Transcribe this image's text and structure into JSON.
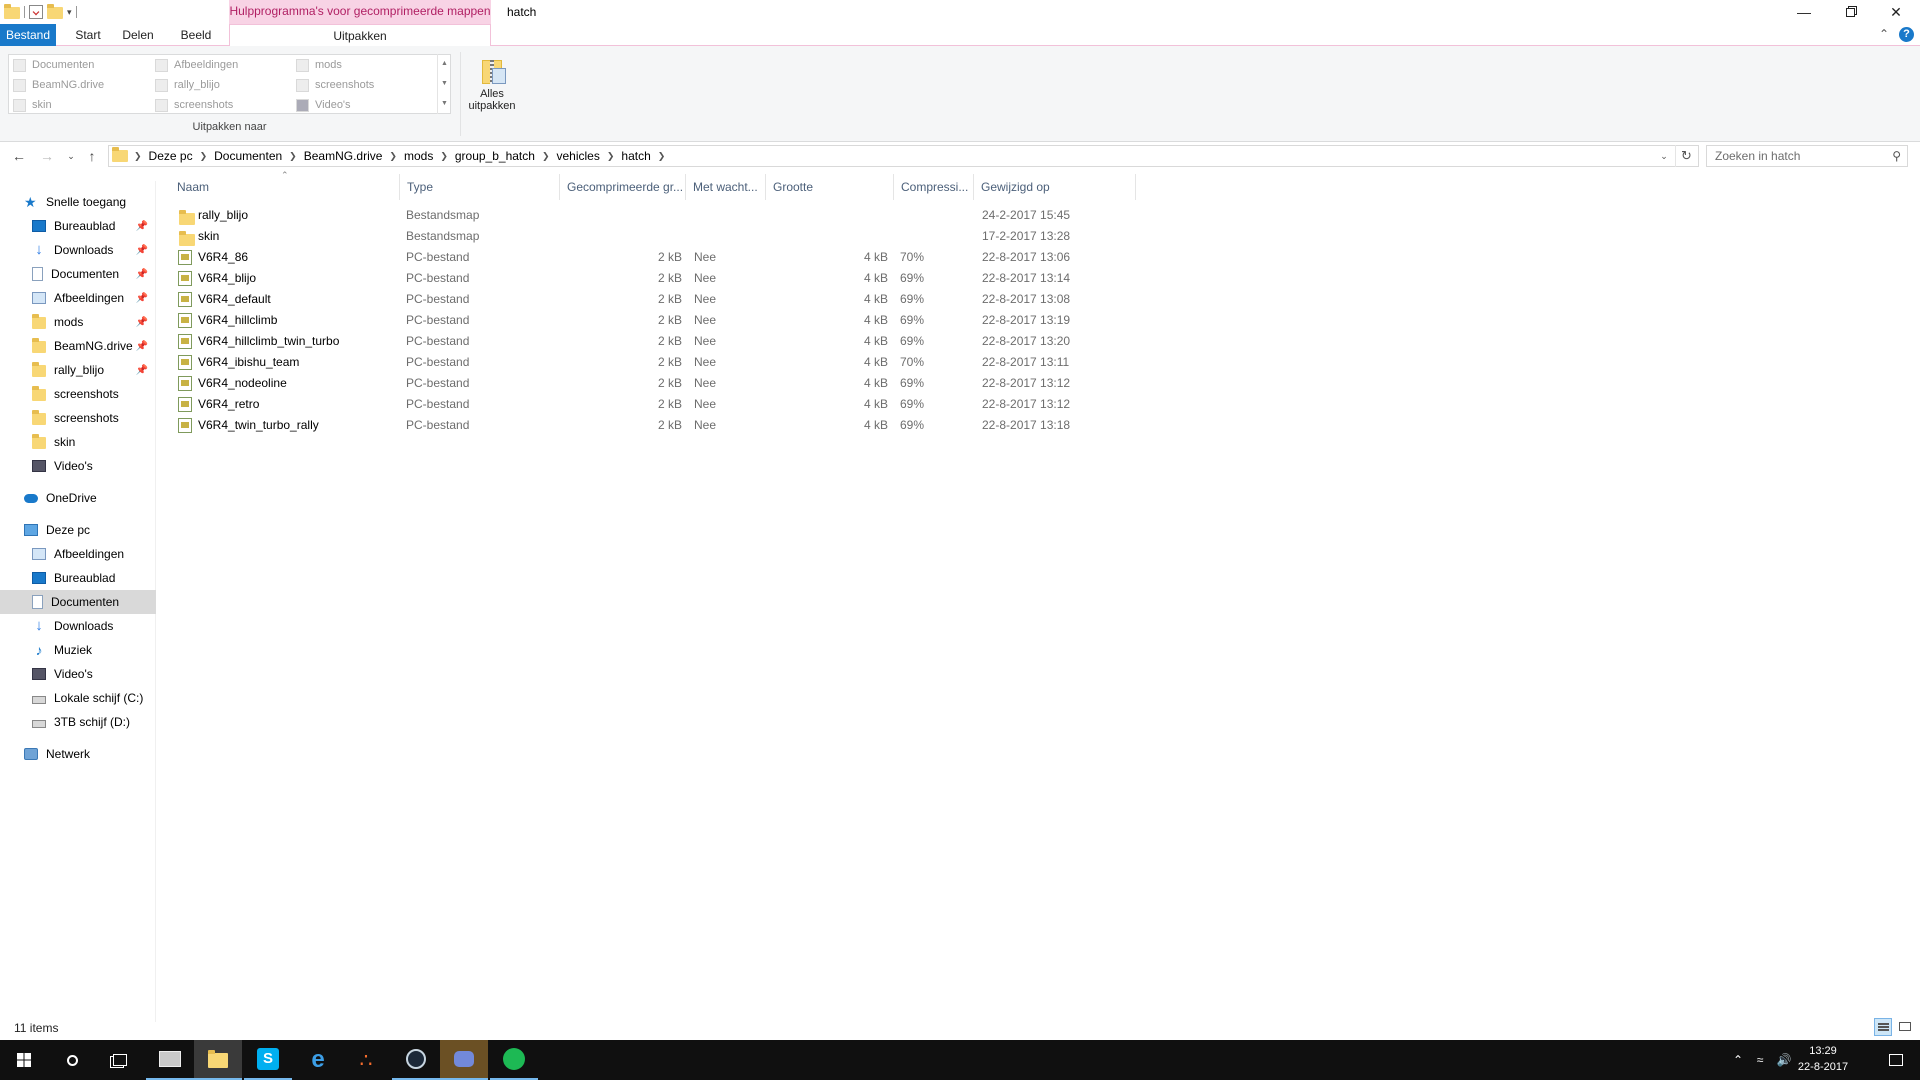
{
  "window": {
    "title": "hatch",
    "context_tab_title": "Hulpprogramma's voor gecomprimeerde mappen"
  },
  "ribbon": {
    "tabs": [
      "Bestand",
      "Start",
      "Delen",
      "Beeld",
      "Uitpakken"
    ],
    "destinations": [
      [
        "Documenten",
        "Afbeeldingen",
        "mods"
      ],
      [
        "BeamNG.drive",
        "rally_blijo",
        "screenshots"
      ],
      [
        "skin",
        "screenshots",
        "Video's"
      ]
    ],
    "group_label": "Uitpakken naar",
    "extract_all_label_1": "Alles",
    "extract_all_label_2": "uitpakken"
  },
  "address": {
    "breadcrumbs": [
      "Deze pc",
      "Documenten",
      "BeamNG.drive",
      "mods",
      "group_b_hatch",
      "vehicles",
      "hatch"
    ]
  },
  "search": {
    "placeholder": "Zoeken in hatch"
  },
  "nav": {
    "quick_access": "Snelle toegang",
    "pinned": [
      "Bureaublad",
      "Downloads",
      "Documenten",
      "Afbeeldingen",
      "mods",
      "BeamNG.drive",
      "rally_blijo"
    ],
    "recent": [
      "screenshots",
      "screenshots",
      "skin",
      "Video's"
    ],
    "onedrive": "OneDrive",
    "this_pc": "Deze pc",
    "this_pc_items": [
      "Afbeeldingen",
      "Bureaublad",
      "Documenten",
      "Downloads",
      "Muziek",
      "Video's",
      "Lokale schijf (C:)",
      "3TB schijf (D:)"
    ],
    "network": "Netwerk"
  },
  "columns": [
    "Naam",
    "Type",
    "Gecomprimeerde gr...",
    "Met wacht...",
    "Grootte",
    "Compressi...",
    "Gewijzigd op"
  ],
  "files": [
    {
      "name": "rally_blijo",
      "type": "Bestandsmap",
      "csize": "",
      "pw": "",
      "size": "",
      "ratio": "",
      "date": "24-2-2017 15:45",
      "kind": "folder"
    },
    {
      "name": "skin",
      "type": "Bestandsmap",
      "csize": "",
      "pw": "",
      "size": "",
      "ratio": "",
      "date": "17-2-2017 13:28",
      "kind": "folder"
    },
    {
      "name": "V6R4_86",
      "type": "PC-bestand",
      "csize": "2 kB",
      "pw": "Nee",
      "size": "4 kB",
      "ratio": "70%",
      "date": "22-8-2017 13:06",
      "kind": "file"
    },
    {
      "name": "V6R4_blijo",
      "type": "PC-bestand",
      "csize": "2 kB",
      "pw": "Nee",
      "size": "4 kB",
      "ratio": "69%",
      "date": "22-8-2017 13:14",
      "kind": "file"
    },
    {
      "name": "V6R4_default",
      "type": "PC-bestand",
      "csize": "2 kB",
      "pw": "Nee",
      "size": "4 kB",
      "ratio": "69%",
      "date": "22-8-2017 13:08",
      "kind": "file"
    },
    {
      "name": "V6R4_hillclimb",
      "type": "PC-bestand",
      "csize": "2 kB",
      "pw": "Nee",
      "size": "4 kB",
      "ratio": "69%",
      "date": "22-8-2017 13:19",
      "kind": "file"
    },
    {
      "name": "V6R4_hillclimb_twin_turbo",
      "type": "PC-bestand",
      "csize": "2 kB",
      "pw": "Nee",
      "size": "4 kB",
      "ratio": "69%",
      "date": "22-8-2017 13:20",
      "kind": "file"
    },
    {
      "name": "V6R4_ibishu_team",
      "type": "PC-bestand",
      "csize": "2 kB",
      "pw": "Nee",
      "size": "4 kB",
      "ratio": "70%",
      "date": "22-8-2017 13:11",
      "kind": "file"
    },
    {
      "name": "V6R4_nodeoline",
      "type": "PC-bestand",
      "csize": "2 kB",
      "pw": "Nee",
      "size": "4 kB",
      "ratio": "69%",
      "date": "22-8-2017 13:12",
      "kind": "file"
    },
    {
      "name": "V6R4_retro",
      "type": "PC-bestand",
      "csize": "2 kB",
      "pw": "Nee",
      "size": "4 kB",
      "ratio": "69%",
      "date": "22-8-2017 13:12",
      "kind": "file"
    },
    {
      "name": "V6R4_twin_turbo_rally",
      "type": "PC-bestand",
      "csize": "2 kB",
      "pw": "Nee",
      "size": "4 kB",
      "ratio": "69%",
      "date": "22-8-2017 13:18",
      "kind": "file"
    }
  ],
  "status": {
    "item_count": "11 items"
  },
  "taskbar": {
    "time": "13:29",
    "date": "22-8-2017"
  },
  "colors": {
    "accent": "#1979ca",
    "context_tab_bg": "#f8d3e5",
    "context_tab_text": "#b01f63",
    "selection": "#d9d9d9",
    "taskbar": "#101010"
  }
}
